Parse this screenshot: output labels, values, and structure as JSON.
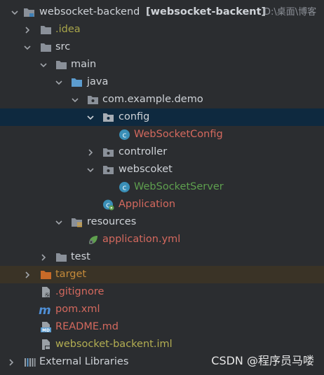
{
  "project": {
    "name": "websocket-backend",
    "module": "[websocket-backent]",
    "path": "D:\\桌面\\博客"
  },
  "tree": {
    "idea": ".idea",
    "src": "src",
    "main": "main",
    "java": "java",
    "package": "com.example.demo",
    "config": "config",
    "websocket_config": "WebSocketConfig",
    "controller": "controller",
    "webscoket": "webscoket",
    "websocket_server": "WebSocketServer",
    "application": "Application",
    "resources": "resources",
    "application_yml": "application.yml",
    "test": "test",
    "target": "target",
    "gitignore": ".gitignore",
    "pom": "pom.xml",
    "readme": "README.md",
    "iml": "websocket-backent.iml",
    "external_libraries": "External Libraries"
  },
  "watermark": "CSDN @程序员马喽",
  "colors": {
    "background": "#2b2d30",
    "selected_row": "#0e293f",
    "target_row": "#3a3326",
    "folder": "#8a9099",
    "source_folder": "#5c9ccf",
    "resource_folder": "#8a9099",
    "excluded_folder": "#c86a28",
    "class_icon": "#3a8fb7",
    "red_text": "#d4695e",
    "green_text": "#5e9f4e",
    "olive_text": "#a8a54a"
  }
}
